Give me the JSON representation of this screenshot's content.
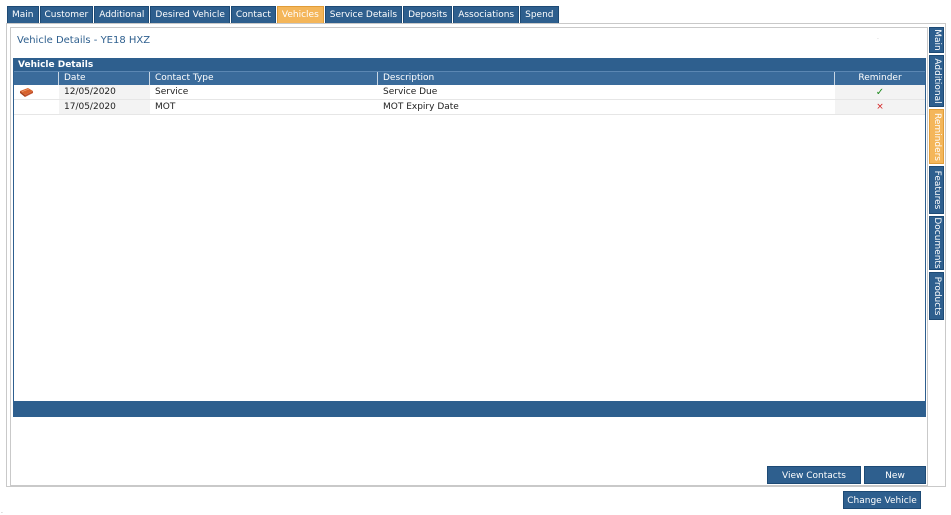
{
  "top_tabs": [
    {
      "label": "Main",
      "active": false
    },
    {
      "label": "Customer",
      "active": false
    },
    {
      "label": "Additional",
      "active": false
    },
    {
      "label": "Desired Vehicle",
      "active": false
    },
    {
      "label": "Contact",
      "active": false
    },
    {
      "label": "Vehicles",
      "active": true
    },
    {
      "label": "Service Details",
      "active": false
    },
    {
      "label": "Deposits",
      "active": false
    },
    {
      "label": "Associations",
      "active": false
    },
    {
      "label": "Spend",
      "active": false
    }
  ],
  "page_title": "Vehicle Details - YE18 HXZ",
  "grid": {
    "title": "Vehicle Details",
    "columns": [
      "",
      "Date",
      "Contact Type",
      "Description",
      "Reminder"
    ],
    "rows": [
      {
        "icon": "book-icon",
        "date": "12/05/2020",
        "contact_type": "Service",
        "description": "Service Due",
        "reminder": "✓"
      },
      {
        "icon": "",
        "date": "17/05/2020",
        "contact_type": "MOT",
        "description": "MOT Expiry Date",
        "reminder": "×"
      }
    ]
  },
  "side_tabs": [
    {
      "label": "Main",
      "active": false
    },
    {
      "label": "Additional",
      "active": false
    },
    {
      "label": "Reminders",
      "active": true
    },
    {
      "label": "Features",
      "active": false
    },
    {
      "label": "Documents",
      "active": false
    },
    {
      "label": "Products",
      "active": false
    }
  ],
  "buttons": {
    "view_contacts": "View Contacts",
    "new": "New",
    "change_vehicle": "Change Vehicle"
  },
  "colors": {
    "primary": "#2e5f8e",
    "active_tab": "#f4b65a",
    "tick": "#1e8a1e",
    "cross": "#d42020"
  }
}
